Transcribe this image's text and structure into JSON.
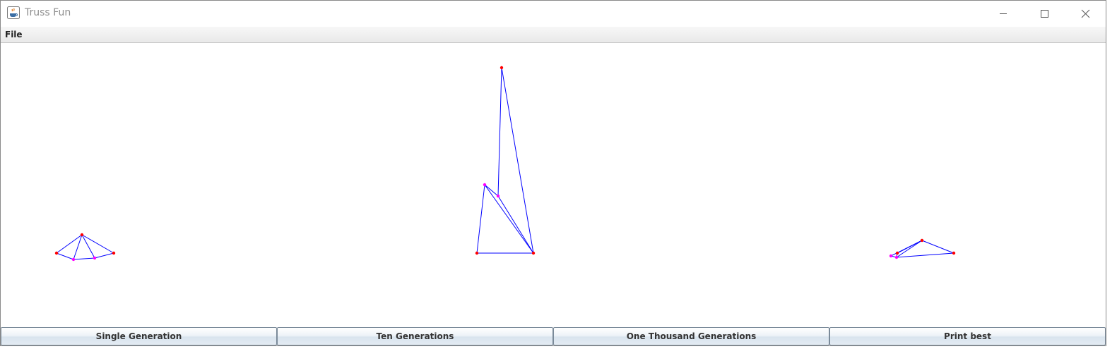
{
  "window": {
    "title": "Truss Fun"
  },
  "menu": {
    "items": [
      {
        "label": "File"
      }
    ]
  },
  "buttons": [
    {
      "label": "Single Generation"
    },
    {
      "label": "Ten Generations"
    },
    {
      "label": "One Thousand Generations"
    },
    {
      "label": "Print best"
    }
  ],
  "colors": {
    "member": "#0000ff",
    "fixed_node": "#ff0000",
    "free_node": "#ff00ff"
  },
  "icons": {
    "app": "java-coffee-icon",
    "minimize": "minimize-icon",
    "maximize": "maximize-icon",
    "close": "close-icon"
  }
}
